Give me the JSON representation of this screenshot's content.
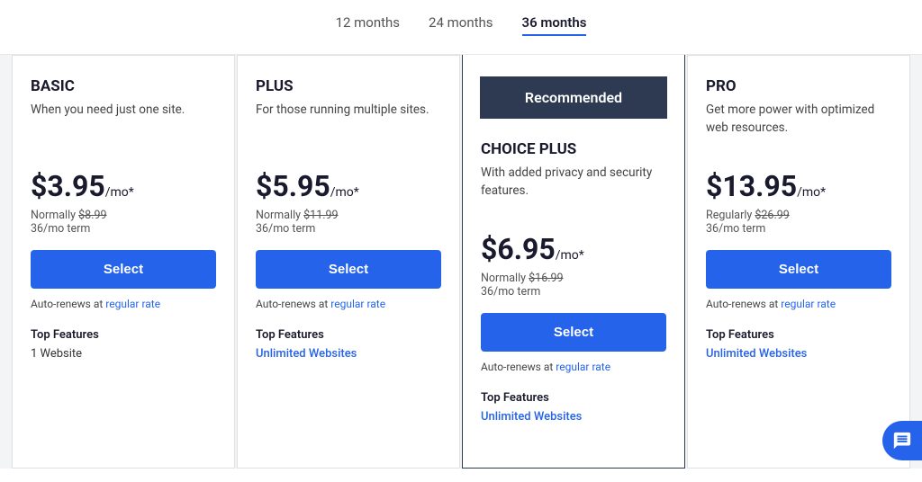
{
  "periodSelector": {
    "tabs": [
      {
        "id": "12",
        "label": "12 months",
        "active": false
      },
      {
        "id": "24",
        "label": "24 months",
        "active": false
      },
      {
        "id": "36",
        "label": "36 months",
        "active": true
      }
    ]
  },
  "plans": [
    {
      "id": "basic",
      "name": "BASIC",
      "desc": "When you need just one site.",
      "price": "$3.95",
      "per": "/mo*",
      "normallyLabel": "Normally",
      "normalPrice": "$8.99",
      "term": "36/mo term",
      "selectLabel": "Select",
      "autoRenewText": "Auto-renews at ",
      "autoRenewLink": "regular rate",
      "topFeaturesLabel": "Top Features",
      "featureItem": "1 Website",
      "featureHighlight": false,
      "recommended": false
    },
    {
      "id": "plus",
      "name": "PLUS",
      "desc": "For those running multiple sites.",
      "price": "$5.95",
      "per": "/mo*",
      "normallyLabel": "Normally",
      "normalPrice": "$11.99",
      "term": "36/mo term",
      "selectLabel": "Select",
      "autoRenewText": "Auto-renews at ",
      "autoRenewLink": "regular rate",
      "topFeaturesLabel": "Top Features",
      "featureItem": "Unlimited Websites",
      "featureHighlight": true,
      "recommended": false
    },
    {
      "id": "choice-plus",
      "name": "CHOICE PLUS",
      "desc": "With added privacy and security features.",
      "price": "$6.95",
      "per": "/mo*",
      "normallyLabel": "Normally",
      "normalPrice": "$16.99",
      "term": "36/mo term",
      "selectLabel": "Select",
      "autoRenewText": "Auto-renews at ",
      "autoRenewLink": "regular rate",
      "topFeaturesLabel": "Top Features",
      "featureItem": "Unlimited Websites",
      "featureHighlight": true,
      "recommended": true,
      "recommendedLabel": "Recommended"
    },
    {
      "id": "pro",
      "name": "PRO",
      "desc": "Get more power with optimized web resources.",
      "price": "$13.95",
      "per": "/mo*",
      "normallyLabel": "Regularly",
      "normalPrice": "$26.99",
      "term": "36/mo term",
      "selectLabel": "Select",
      "autoRenewText": "Auto-renews at ",
      "autoRenewLink": "regular rate",
      "topFeaturesLabel": "Top Features",
      "featureItem": "Unlimited Websites",
      "featureHighlight": true,
      "recommended": false
    }
  ]
}
